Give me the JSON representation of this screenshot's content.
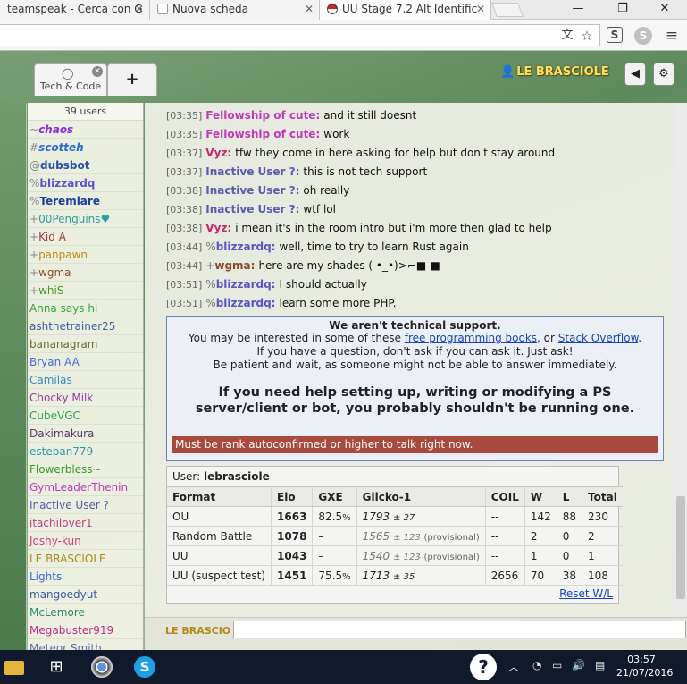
{
  "browser": {
    "tabs": [
      {
        "title": "teamspeak - Cerca con G"
      },
      {
        "title": "Nuova scheda"
      },
      {
        "title": "UU Stage 7.2 Alt Identific"
      }
    ]
  },
  "ps": {
    "room_tab_label": "Tech & Code",
    "add_tab_label": "+",
    "username": "LE BRASCIOLE"
  },
  "userlist": {
    "count": "39 users",
    "users": [
      {
        "group": "~",
        "name": "chaos",
        "color": "#8a2be2",
        "style": "bold it"
      },
      {
        "group": "#",
        "name": "scotteh",
        "color": "#2a6bd6",
        "style": "bold it"
      },
      {
        "group": "@",
        "name": "dubsbot",
        "color": "#2a4fa8",
        "style": "bold"
      },
      {
        "group": "%",
        "name": "blizzardq",
        "color": "#5a54c8",
        "style": "bold"
      },
      {
        "group": "%",
        "name": "Teremiare",
        "color": "#1a3d9e",
        "style": "bold"
      },
      {
        "group": "+",
        "name": "00Penguins♥",
        "color": "#2f9f9f",
        "style": ""
      },
      {
        "group": "+",
        "name": "Kid A",
        "color": "#9e3a3a",
        "style": ""
      },
      {
        "group": "+",
        "name": "panpawn",
        "color": "#c28a12",
        "style": ""
      },
      {
        "group": "+",
        "name": "wgma",
        "color": "#8a4a2a",
        "style": ""
      },
      {
        "group": "+",
        "name": "whiS",
        "color": "#4a9a2a",
        "style": ""
      },
      {
        "group": "",
        "name": "Anna says hi",
        "color": "#3aa63a",
        "style": ""
      },
      {
        "group": "",
        "name": "ashthetrainer25",
        "color": "#3d5e9e",
        "style": ""
      },
      {
        "group": "",
        "name": "bananagram",
        "color": "#6e6e2a",
        "style": ""
      },
      {
        "group": "",
        "name": "Bryan AA",
        "color": "#4a6ad6",
        "style": ""
      },
      {
        "group": "",
        "name": "Camilas",
        "color": "#3a8ac0",
        "style": ""
      },
      {
        "group": "",
        "name": "Chocky Milk",
        "color": "#9a3aa8",
        "style": ""
      },
      {
        "group": "",
        "name": "CubeVGC",
        "color": "#2aa64a",
        "style": ""
      },
      {
        "group": "",
        "name": "Dakimakura",
        "color": "#5a3a6a",
        "style": ""
      },
      {
        "group": "",
        "name": "esteban779",
        "color": "#2a9aa8",
        "style": ""
      },
      {
        "group": "",
        "name": "Flowerbless~",
        "color": "#3a9a2a",
        "style": ""
      },
      {
        "group": "",
        "name": "GymLeaderThenin",
        "color": "#c03ac0",
        "style": ""
      },
      {
        "group": "",
        "name": "Inactive User ?",
        "color": "#5a5aa8",
        "style": ""
      },
      {
        "group": "",
        "name": "itachilover1",
        "color": "#c03a8a",
        "style": ""
      },
      {
        "group": "",
        "name": "Joshy-kun",
        "color": "#d63a7a",
        "style": ""
      },
      {
        "group": "",
        "name": "LE BRASCIOLE",
        "color": "#a88a1a",
        "style": ""
      },
      {
        "group": "",
        "name": "Lights",
        "color": "#3a6ad6",
        "style": ""
      },
      {
        "group": "",
        "name": "mangoedyut",
        "color": "#3a5aa8",
        "style": ""
      },
      {
        "group": "",
        "name": "McLemore",
        "color": "#2a8a6a",
        "style": ""
      },
      {
        "group": "",
        "name": "Megabuster919",
        "color": "#c02a8a",
        "style": ""
      },
      {
        "group": "",
        "name": "Meteor Smith",
        "color": "#6a6aa8",
        "style": ""
      }
    ]
  },
  "chat": {
    "messages": [
      {
        "time": "[03:35]",
        "group": "",
        "nick": "Fellowship of cute:",
        "color": "#c23ab8",
        "text": "and it still doesnt"
      },
      {
        "time": "[03:35]",
        "group": "",
        "nick": "Fellowship of cute:",
        "color": "#c23ab8",
        "text": "work"
      },
      {
        "time": "[03:37]",
        "group": "",
        "nick": "Vyz:",
        "color": "#c22a6a",
        "text": "tfw they come in here asking for help but don't stay around"
      },
      {
        "time": "[03:37]",
        "group": "",
        "nick": "Inactive User ?:",
        "color": "#5a5ab0",
        "text": "this is not tech support"
      },
      {
        "time": "[03:38]",
        "group": "",
        "nick": "Inactive User ?:",
        "color": "#5a5ab0",
        "text": "oh really"
      },
      {
        "time": "[03:38]",
        "group": "",
        "nick": "Inactive User ?:",
        "color": "#5a5ab0",
        "text": "wtf lol"
      },
      {
        "time": "[03:38]",
        "group": "",
        "nick": "Vyz:",
        "color": "#c22a6a",
        "text": "i mean it's in the room intro but i'm more then glad to help"
      },
      {
        "time": "[03:44]",
        "group": "%",
        "nick": "blizzardq:",
        "color": "#5a54c8",
        "text": "well, time to try to learn Rust again"
      },
      {
        "time": "[03:44]",
        "group": "+",
        "nick": "wgma:",
        "color": "#8a4a2a",
        "text": "here are my shades ( •_•)>⌐■-■"
      },
      {
        "time": "[03:51]",
        "group": "%",
        "nick": "blizzardq:",
        "color": "#5a54c8",
        "text": "I should actually"
      },
      {
        "time": "[03:51]",
        "group": "%",
        "nick": "blizzardq:",
        "color": "#5a54c8",
        "text": "learn some more PHP."
      }
    ]
  },
  "intro": {
    "title": "We aren't technical support.",
    "line1_pre": "You may be interested in some of these ",
    "link1": "free programming books",
    "line1_mid": ", or ",
    "link2": "Stack Overflow",
    "line1_post": ".",
    "line2": "If you have a question, don't ask if you can ask it. Just ask!",
    "line3": "Be patient and wait, as someone might not be able to answer immediately.",
    "big": "If you need help setting up, writing or modifying a PS server/client or bot, you probably shouldn't be running one.",
    "warning": "Must be rank autoconfirmed or higher to talk right now."
  },
  "stats": {
    "user_label": "User:",
    "user_name": "lebrasciole",
    "headers": [
      "Format",
      "Elo",
      "GXE",
      "Glicko-1",
      "COIL",
      "W",
      "L",
      "Total"
    ],
    "rows": [
      {
        "format": "OU",
        "elo": "1663",
        "gxe": "82.5",
        "gxe_pct": "%",
        "glicko": "1793",
        "glicko_pm": "± 27",
        "prov": "",
        "coil": "--",
        "w": "142",
        "l": "88",
        "total": "230"
      },
      {
        "format": "Random Battle",
        "elo": "1078",
        "gxe": "–",
        "gxe_pct": "",
        "glicko": "1565",
        "glicko_pm": "± 123",
        "prov": "(provisional)",
        "coil": "--",
        "w": "2",
        "l": "0",
        "total": "2"
      },
      {
        "format": "UU",
        "elo": "1043",
        "gxe": "–",
        "gxe_pct": "",
        "glicko": "1540",
        "glicko_pm": "± 123",
        "prov": "(provisional)",
        "coil": "--",
        "w": "1",
        "l": "0",
        "total": "1"
      },
      {
        "format": "UU (suspect test)",
        "elo": "1451",
        "gxe": "75.5",
        "gxe_pct": "%",
        "glicko": "1713",
        "glicko_pm": "± 35",
        "prov": "",
        "coil": "2656",
        "w": "70",
        "l": "38",
        "total": "108"
      }
    ],
    "reset_label": "Reset W/L"
  },
  "input": {
    "name": "LE BRASCIO"
  },
  "taskbar": {
    "time": "03:57",
    "date": "21/07/2016"
  }
}
